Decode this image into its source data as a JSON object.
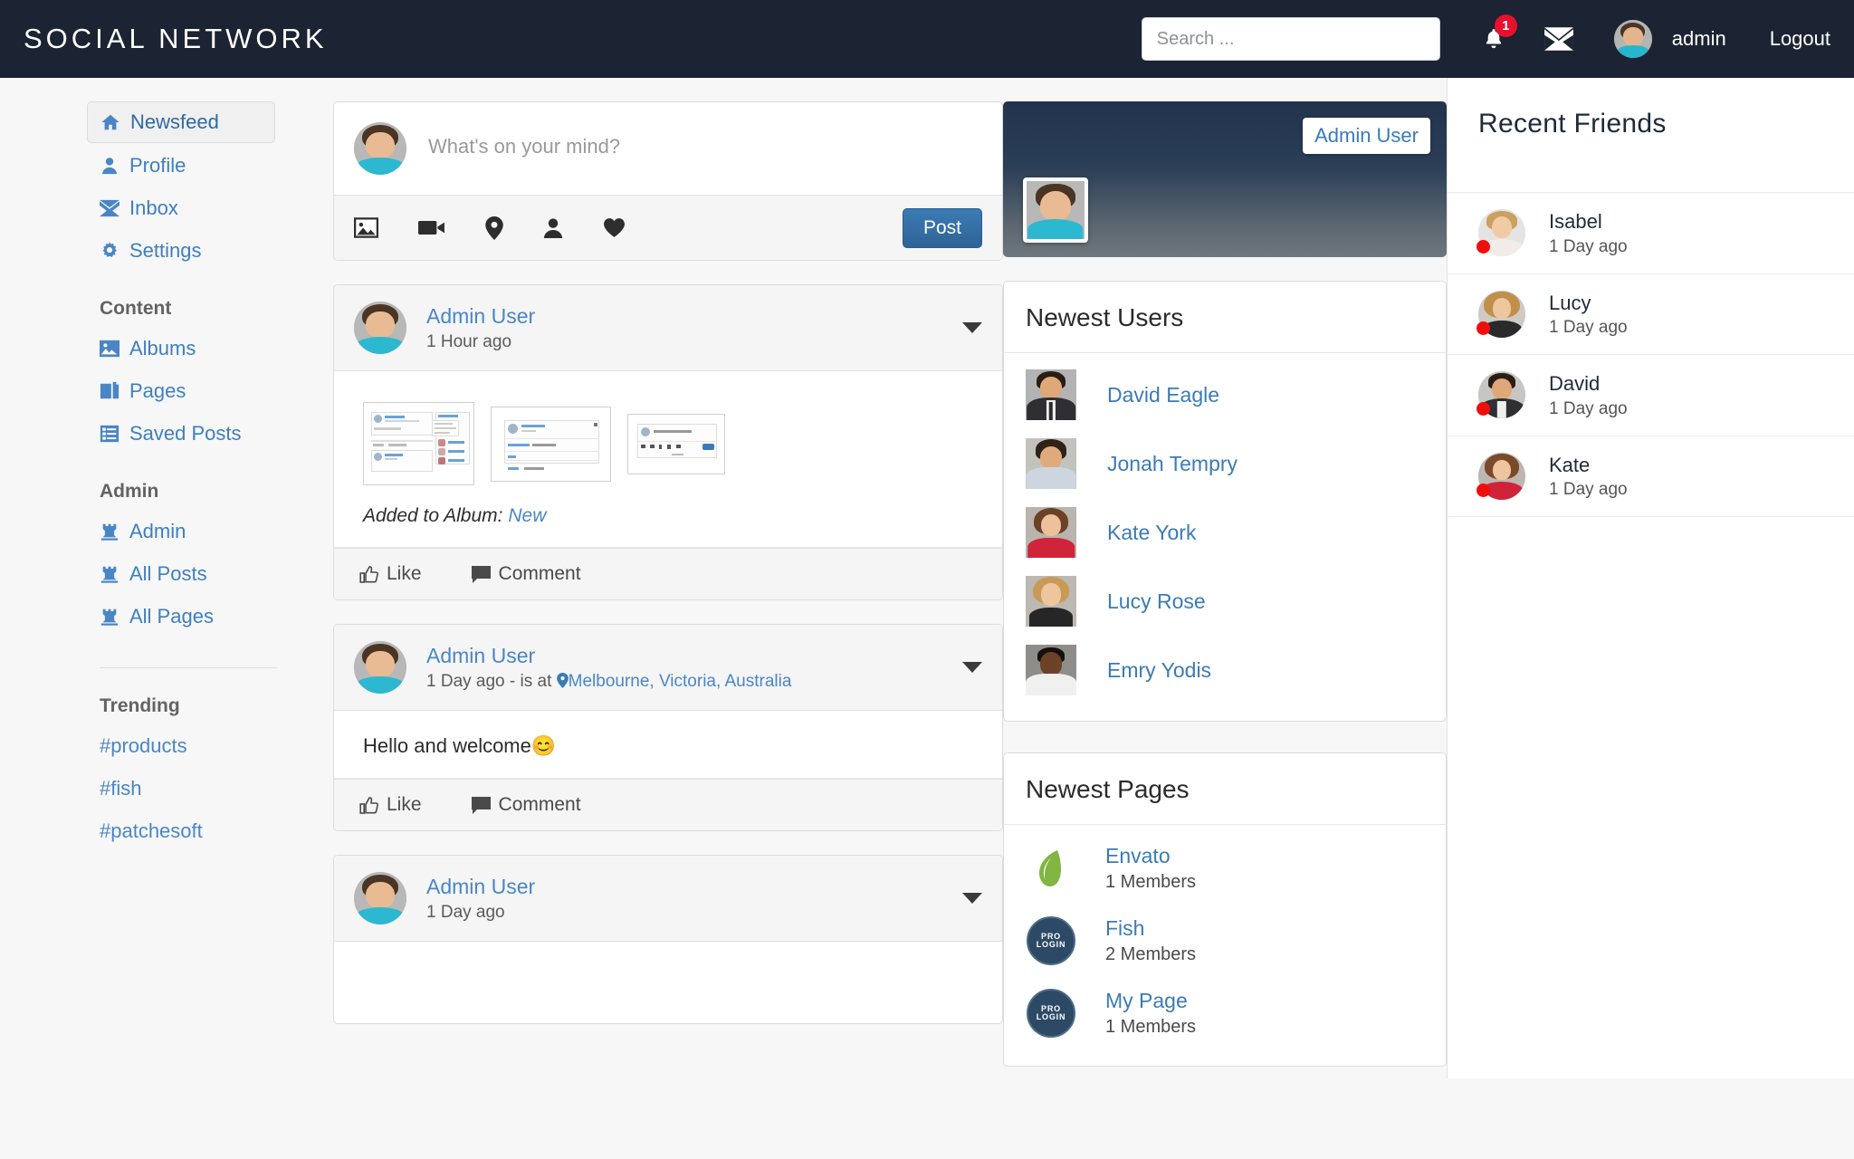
{
  "header": {
    "brand": "SOCIAL NETWORK",
    "search_placeholder": "Search ...",
    "notification_count": "1",
    "username": "admin",
    "logout_label": "Logout",
    "icons": {
      "bell": "bell-icon",
      "mail": "envelope-icon"
    }
  },
  "sidebar": {
    "main_items": [
      {
        "label": "Newsfeed",
        "icon": "home-icon",
        "active": true
      },
      {
        "label": "Profile",
        "icon": "user-icon",
        "active": false
      },
      {
        "label": "Inbox",
        "icon": "envelope-icon",
        "active": false
      },
      {
        "label": "Settings",
        "icon": "gear-icon",
        "active": false
      }
    ],
    "content_heading": "Content",
    "content_items": [
      {
        "label": "Albums",
        "icon": "photo-icon"
      },
      {
        "label": "Pages",
        "icon": "pages-icon"
      },
      {
        "label": "Saved Posts",
        "icon": "list-icon"
      }
    ],
    "admin_heading": "Admin",
    "admin_items": [
      {
        "label": "Admin",
        "icon": "chess-rook-icon"
      },
      {
        "label": "All Posts",
        "icon": "chess-rook-icon"
      },
      {
        "label": "All Pages",
        "icon": "chess-rook-icon"
      }
    ],
    "trending_heading": "Trending",
    "trending_tags": [
      "#products",
      "#fish",
      "#patchesoft"
    ]
  },
  "composer": {
    "placeholder": "What's on your mind?",
    "post_button": "Post",
    "tools": [
      {
        "name": "photo-icon"
      },
      {
        "name": "video-icon"
      },
      {
        "name": "location-icon"
      },
      {
        "name": "tag-person-icon"
      },
      {
        "name": "feeling-heart-icon"
      }
    ]
  },
  "feed": {
    "like_label": "Like",
    "comment_label": "Comment",
    "posts": [
      {
        "author": "Admin User",
        "time": "1 Hour ago",
        "type": "album",
        "album_prefix": "Added to Album:",
        "album_name": "New",
        "thumb_count": 3
      },
      {
        "author": "Admin User",
        "time": "1 Day ago",
        "location_prefix": "- is at",
        "location": "Melbourne, Victoria, Australia",
        "type": "text",
        "text": "Hello and welcome😊"
      },
      {
        "author": "Admin User",
        "time": "1 Day ago",
        "type": "text",
        "text": ""
      }
    ]
  },
  "profile_card": {
    "name": "Admin User"
  },
  "newest_users": {
    "title": "Newest Users",
    "users": [
      {
        "name": "David Eagle"
      },
      {
        "name": "Jonah Tempry"
      },
      {
        "name": "Kate York"
      },
      {
        "name": "Lucy Rose"
      },
      {
        "name": "Emry Yodis"
      }
    ]
  },
  "newest_pages": {
    "title": "Newest Pages",
    "pages": [
      {
        "name": "Envato",
        "members": "1 Members",
        "logo": "envato-leaf-icon"
      },
      {
        "name": "Fish",
        "members": "2 Members",
        "logo": "pro-login-badge-icon"
      },
      {
        "name": "My Page",
        "members": "1 Members",
        "logo": "pro-login-badge-icon"
      }
    ],
    "badge_line1": "PRO",
    "badge_line2": "LOGIN"
  },
  "recent_friends": {
    "title": "Recent Friends",
    "friends": [
      {
        "name": "Isabel",
        "time": "1 Day ago"
      },
      {
        "name": "Lucy",
        "time": "1 Day ago"
      },
      {
        "name": "David",
        "time": "1 Day ago"
      },
      {
        "name": "Kate",
        "time": "1 Day ago"
      }
    ]
  },
  "colors": {
    "navbar": "#1c2333",
    "link": "#3b7bb5",
    "badge": "#e8112d",
    "status_dot": "#f20d0d",
    "primary_button": "#3b7bb5",
    "envato_green": "#82b541"
  }
}
